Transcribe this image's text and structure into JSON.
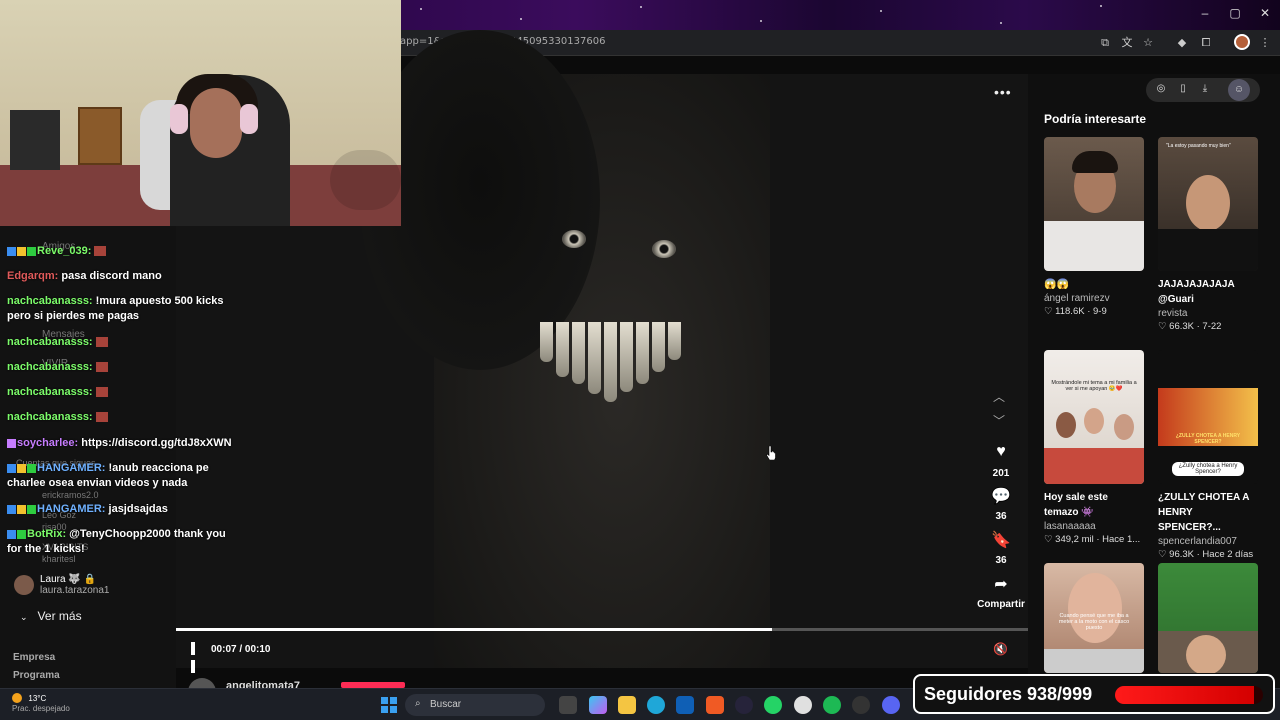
{
  "browser": {
    "url": "app=1&web_id=7453545095330137606"
  },
  "sidebar": {
    "ghost_labels": [
      "Amigos",
      "Mensajes",
      "VIVIR",
      "Cuentas que sigues",
      "erickramos2.0",
      "Leo Goz",
      "risa00",
      "XVARIBITS",
      "kharitesl"
    ],
    "followed": {
      "name": "Laura 🐺 🔒",
      "handle": "laura.tarazona1"
    },
    "see_more": "Ver más",
    "footer": [
      "Empresa",
      "Programa"
    ]
  },
  "chat": [
    {
      "user": "Reve_039:",
      "text": "",
      "user_color": "#7CFC6A",
      "emote": true,
      "badges": [
        "#3a8df0",
        "#f2c12e",
        "#2ecc40"
      ]
    },
    {
      "user": "Edgarqm:",
      "text": "pasa discord mano",
      "user_color": "#e05a5a",
      "emote": false,
      "badges": []
    },
    {
      "user": "nachcabanasss:",
      "text": "!mura apuesto 500 kicks pero si pierdes me pagas",
      "user_color": "#7CFC6A",
      "emote": false,
      "badges": []
    },
    {
      "user": "nachcabanasss:",
      "text": "",
      "user_color": "#7CFC6A",
      "emote": true,
      "badges": []
    },
    {
      "user": "nachcabanasss:",
      "text": "",
      "user_color": "#7CFC6A",
      "emote": true,
      "badges": []
    },
    {
      "user": "nachcabanasss:",
      "text": "",
      "user_color": "#7CFC6A",
      "emote": true,
      "badges": []
    },
    {
      "user": "nachcabanasss:",
      "text": "",
      "user_color": "#7CFC6A",
      "emote": true,
      "badges": []
    },
    {
      "user": "soycharlee:",
      "text": "https://discord.gg/tdJ8xXWN",
      "user_color": "#c77dff",
      "emote": false,
      "badges": [
        "#c77dff"
      ]
    },
    {
      "user": "HANGAMER:",
      "text": "!anub reacciona pe charlee osea envian videos y nada",
      "user_color": "#6fb1ff",
      "emote": false,
      "badges": [
        "#3a8df0",
        "#f2c12e",
        "#2ecc40"
      ]
    },
    {
      "user": "HANGAMER:",
      "text": "jasjdsajdas",
      "user_color": "#6fb1ff",
      "emote": false,
      "badges": [
        "#3a8df0",
        "#f2c12e",
        "#2ecc40"
      ]
    },
    {
      "user": "BotRix:",
      "text": "@TenyChoopp2000 thank you for the 1 kicks!",
      "user_color": "#7CFC6A",
      "emote": false,
      "badges": [
        "#3a8df0",
        "#2ecc40"
      ]
    }
  ],
  "video": {
    "time": "00:07 / 00:10",
    "progress_percent": 70,
    "author": "angelitomata7",
    "likes": "201",
    "comments": "36",
    "saves": "36",
    "share_label": "Compartir"
  },
  "right_panel": {
    "title": "Podría interesarte",
    "cards": [
      {
        "caption": "😱😱",
        "user": "ángel ramirezv",
        "stats": "♡ 118.6K · 9-9"
      },
      {
        "caption": "JAJAJAJAJAJA @Guari",
        "user": "revista",
        "stats": "♡ 66.3K · 7-22",
        "overlay": "\"La estoy pasando muy bien\""
      },
      {
        "caption": "Hoy sale este temazo 👾",
        "user": "lasanaaaaa",
        "stats": "♡ 349,2 mil · Hace 1...",
        "overlay": "Mostrándole mi tema a mi familia a ver si me apoyan 🥹❤️"
      },
      {
        "caption": "¿ZULLY CHOTEA A HENRY SPENCER?...",
        "user": "spencerlandia007",
        "stats": "♡ 96.3K · Hace 2 días",
        "overlay": "¿Zully chotea a Henry Spencer?",
        "banner": "¿ZULLY CHOTEA A HENRY SPENCER?"
      },
      {
        "caption": "",
        "user": "",
        "stats": "",
        "overlay": "Cuando pensé que me iba a meter a la moto con el casco puesto"
      },
      {
        "caption": "",
        "user": "",
        "stats": ""
      }
    ]
  },
  "taskbar": {
    "temp": "13°C",
    "weather": "Prac. despejado",
    "search": "Buscar"
  },
  "followers_overlay": {
    "label": "Seguidores 938/999",
    "current": 938,
    "goal": 999
  },
  "colors": {
    "accent": "#fe2c55",
    "followers_bar": "#ff1a1a"
  }
}
